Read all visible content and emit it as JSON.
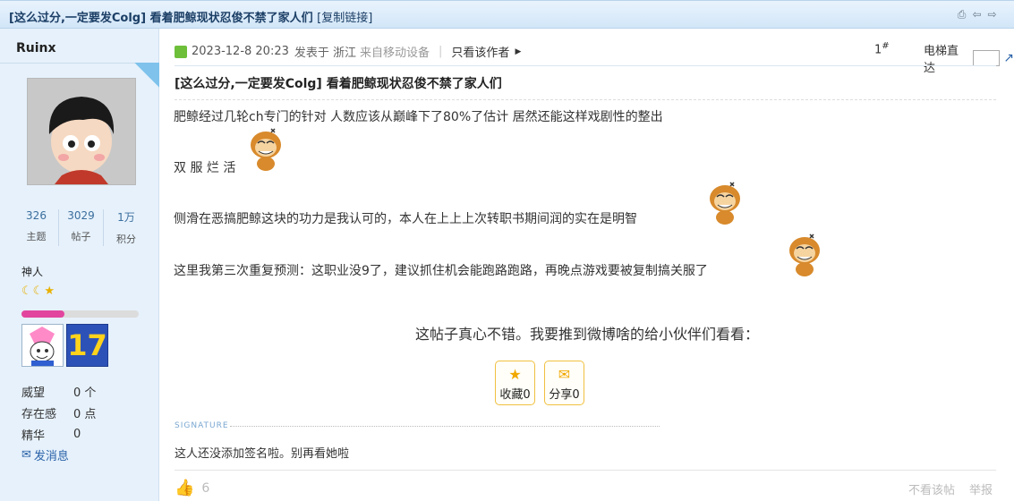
{
  "thread": {
    "title_bracketed": "[这么过分,一定要发Colg] 看着肥鲸现状忍俊不禁了家人们",
    "copy_link": "[复制链接]"
  },
  "author": {
    "name": "Ruinx",
    "stats": [
      {
        "value": "326",
        "label": "主题"
      },
      {
        "value": "3029",
        "label": "帖子"
      },
      {
        "value": "1万",
        "label": "积分"
      }
    ],
    "group": "神人",
    "level_progress": 0.37,
    "medal_text": "17",
    "props": [
      {
        "key": "威望",
        "value": "0 个"
      },
      {
        "key": "存在感",
        "value": "0 点"
      },
      {
        "key": "精华",
        "value": "0"
      }
    ],
    "pm_label": "发消息"
  },
  "post": {
    "date": "2023-12-8 20:23",
    "posted_in": "发表于 浙江",
    "source": "来自移动设备",
    "only_author": "只看该作者",
    "floor": "1",
    "floor_sup": "#",
    "jump_label": "电梯直达",
    "title": "[这么过分,一定要发Colg] 看着肥鲸现状忍俊不禁了家人们",
    "paragraphs": [
      "肥鲸经过几轮ch专门的针对 人数应该从巅峰下了80%了估计 居然还能这样戏剧性的整出",
      "双 服 烂 活",
      "侧滑在恶搞肥鲸这块的功力是我认可的，本人在上上上次转职书期间润的实在是明智",
      "这里我第三次重复预测：这职业没9了，建议抓住机会能跑路跑路，再晚点游戏要被复制搞关服了"
    ],
    "share_prompt": "这帖子真心不错。我要推到微博啥的给小伙伴们看看：",
    "favorite_label": "收藏0",
    "share_label": "分享0",
    "signature_heading": "SIGNATURE",
    "signature": "这人还没添加签名啦。别再看她啦",
    "likes": "6",
    "hide_label": "不看该帖",
    "report_label": "举报"
  }
}
